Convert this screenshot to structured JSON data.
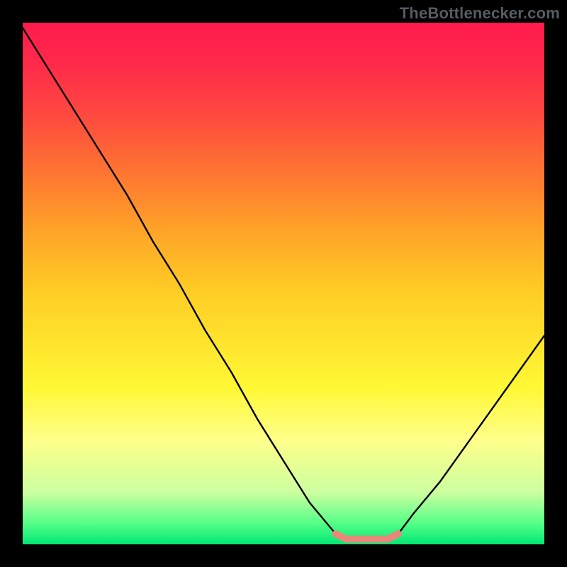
{
  "watermark": "TheBottlenecker.com",
  "colors": {
    "frame": "#000000",
    "curve": "#000000",
    "segment": "#e9877b",
    "gradient_top": "#ff1a4d",
    "gradient_bottom": "#00e874"
  },
  "chart_data": {
    "type": "line",
    "title": "",
    "xlabel": "",
    "ylabel": "",
    "xlim": [
      0,
      100
    ],
    "ylim": [
      0,
      100
    ],
    "x": [
      0,
      5,
      10,
      15,
      20,
      25,
      30,
      35,
      40,
      45,
      50,
      55,
      60,
      62,
      66,
      70,
      72,
      75,
      80,
      85,
      90,
      95,
      100
    ],
    "values": [
      99,
      91,
      83,
      75,
      67,
      58,
      50,
      41,
      33,
      24,
      16,
      8,
      2,
      1,
      1,
      1,
      2,
      6,
      12,
      19,
      26,
      33,
      40
    ],
    "series": [
      {
        "name": "bottleneck-curve",
        "x": [
          0,
          5,
          10,
          15,
          20,
          25,
          30,
          35,
          40,
          45,
          50,
          55,
          60,
          62,
          66,
          70,
          72,
          75,
          80,
          85,
          90,
          95,
          100
        ],
        "values": [
          99,
          91,
          83,
          75,
          67,
          58,
          50,
          41,
          33,
          24,
          16,
          8,
          2,
          1,
          1,
          1,
          2,
          6,
          12,
          19,
          26,
          33,
          40
        ]
      },
      {
        "name": "optimal-segment",
        "x": [
          60,
          62,
          66,
          70,
          72
        ],
        "values": [
          2,
          1,
          1,
          1,
          2
        ]
      }
    ],
    "annotations": [],
    "legend": false,
    "grid": false
  }
}
